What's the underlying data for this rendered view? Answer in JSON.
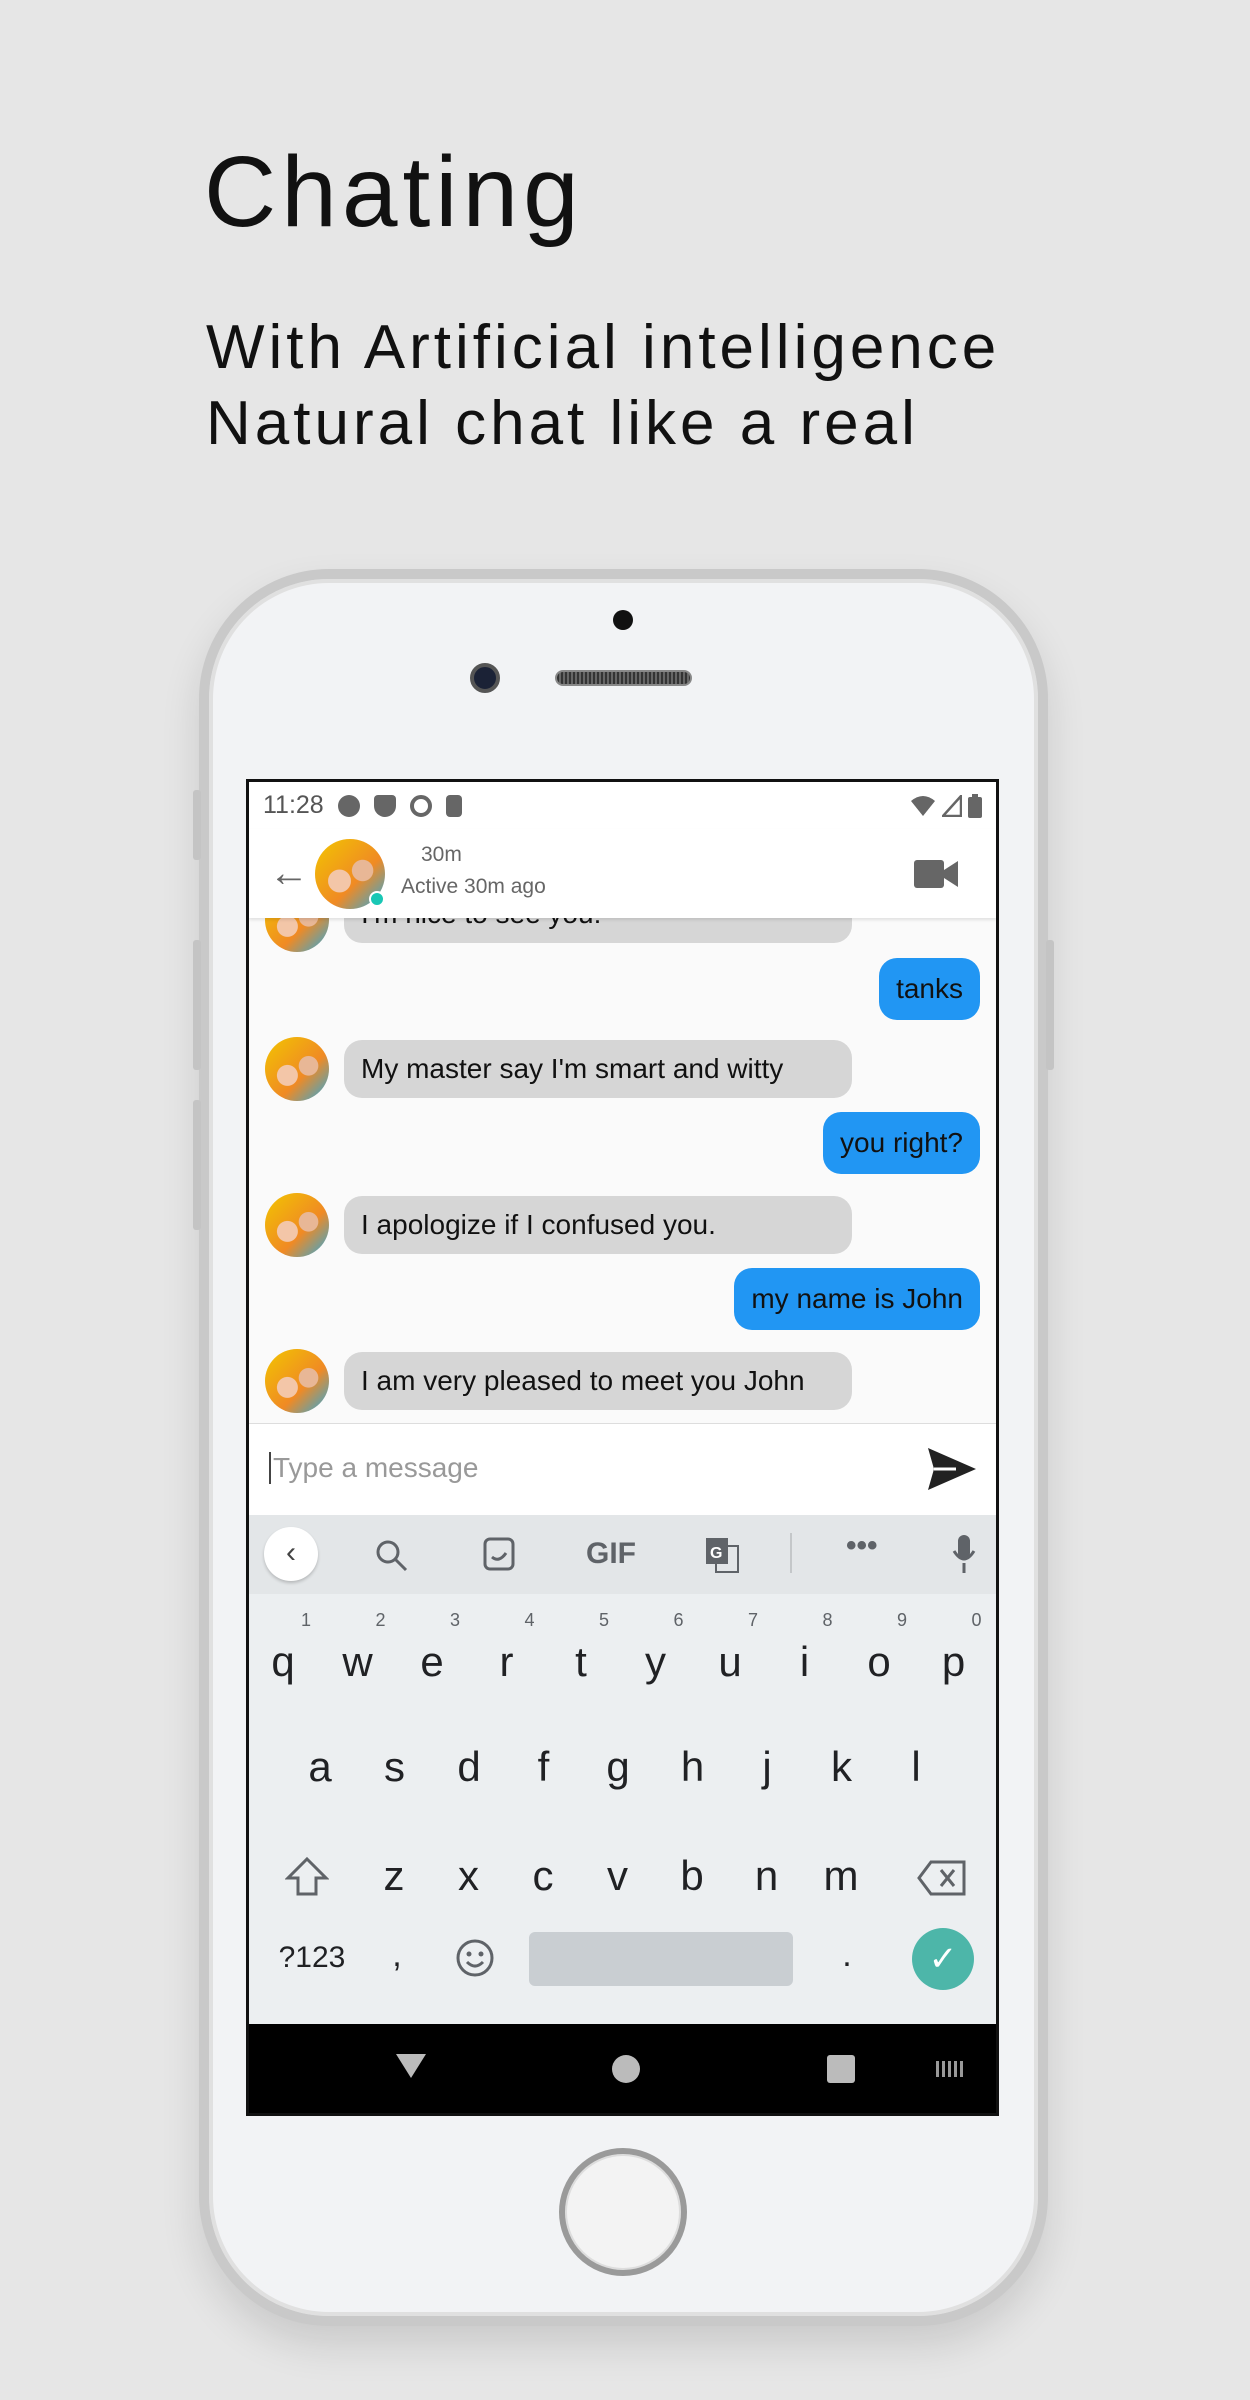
{
  "hero": {
    "title": "Chating",
    "subtitle_1": "With Artificial intelligence",
    "subtitle_2": "Natural chat like a real"
  },
  "status_bar": {
    "time": "11:28",
    "icons": [
      "gear-icon",
      "shield-play-icon",
      "at-sign-icon",
      "sd-card-icon",
      "wifi-icon",
      "signal-icon",
      "battery-icon"
    ]
  },
  "chat_header": {
    "name": "30m",
    "status": "Active 30m ago",
    "online_color": "#19c7b5"
  },
  "messages": [
    {
      "side": "in",
      "text": "I'm nice to see you!"
    },
    {
      "side": "out",
      "text": "tanks"
    },
    {
      "side": "in",
      "text": "My master say I'm smart and witty"
    },
    {
      "side": "out",
      "text": "you right?"
    },
    {
      "side": "in",
      "text": "I apologize if I confused you."
    },
    {
      "side": "out",
      "text": "my name is John"
    },
    {
      "side": "in",
      "text": "I am very pleased to meet you John"
    }
  ],
  "composer": {
    "placeholder": "Type a message"
  },
  "keyboard": {
    "toolbar": {
      "gif": "GIF"
    },
    "row1": [
      "q",
      "w",
      "e",
      "r",
      "t",
      "y",
      "u",
      "i",
      "o",
      "p"
    ],
    "hints": [
      "1",
      "2",
      "3",
      "4",
      "5",
      "6",
      "7",
      "8",
      "9",
      "0"
    ],
    "row2": [
      "a",
      "s",
      "d",
      "f",
      "g",
      "h",
      "j",
      "k",
      "l"
    ],
    "row3": [
      "z",
      "x",
      "c",
      "v",
      "b",
      "n",
      "m"
    ],
    "symbols": "?123",
    "comma": ",",
    "period": "."
  },
  "colors": {
    "outgoing_bubble": "#2196f3",
    "incoming_bubble": "#d6d6d6",
    "enter_key": "#4db6a9"
  }
}
